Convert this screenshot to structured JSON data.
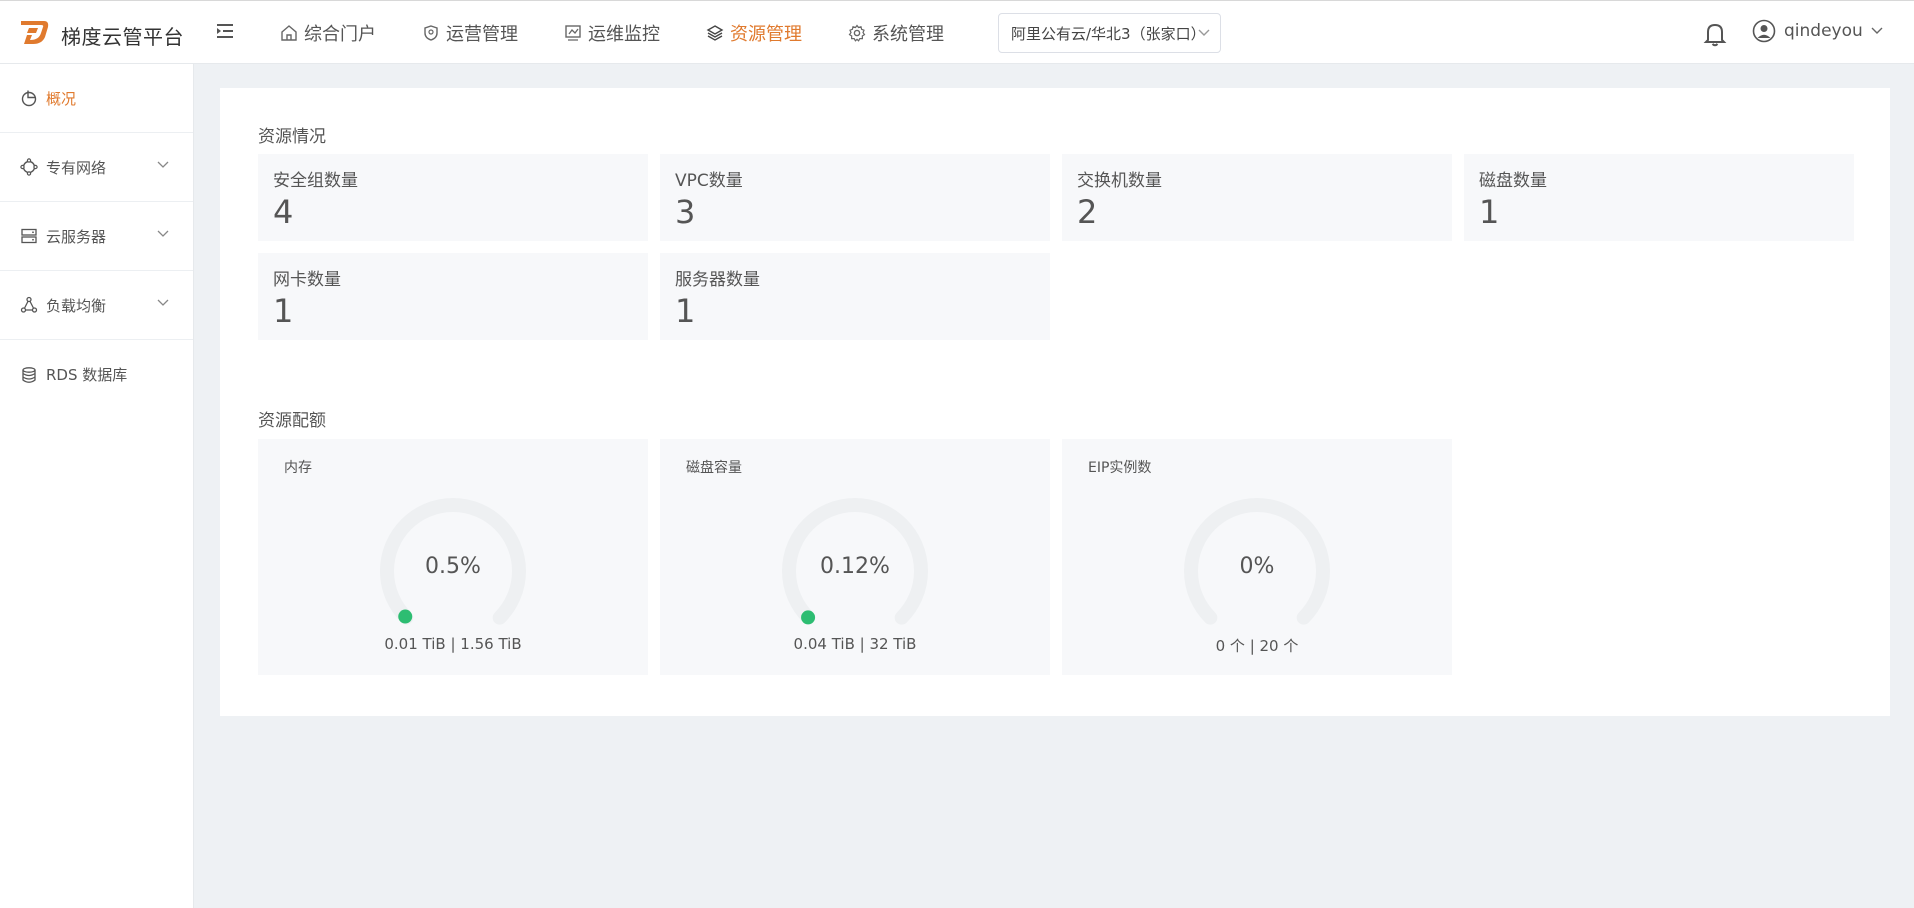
{
  "header": {
    "brand": "梯度云管平台",
    "nav": [
      {
        "label": "综合门户",
        "icon": "home-icon"
      },
      {
        "label": "运营管理",
        "icon": "shield-icon"
      },
      {
        "label": "运维监控",
        "icon": "monitor-icon"
      },
      {
        "label": "资源管理",
        "icon": "layers-icon",
        "active": true
      },
      {
        "label": "系统管理",
        "icon": "gear-icon"
      }
    ],
    "region": "阿里公有云/华北3（张家口）",
    "username": "qindeyou",
    "accent_color": "#e07a2e"
  },
  "sidebar": {
    "items": [
      {
        "label": "概况",
        "icon": "pie-chart-icon",
        "active": true,
        "expandable": false
      },
      {
        "label": "专有网络",
        "icon": "network-icon",
        "expandable": true
      },
      {
        "label": "云服务器",
        "icon": "server-icon",
        "expandable": true
      },
      {
        "label": "负载均衡",
        "icon": "load-balance-icon",
        "expandable": true
      },
      {
        "label": "RDS 数据库",
        "icon": "database-icon",
        "expandable": false
      }
    ]
  },
  "overview": {
    "title": "资源情况",
    "stats": [
      {
        "label": "安全组数量",
        "value": "4"
      },
      {
        "label": "VPC数量",
        "value": "3"
      },
      {
        "label": "交换机数量",
        "value": "2"
      },
      {
        "label": "磁盘数量",
        "value": "1"
      },
      {
        "label": "网卡数量",
        "value": "1"
      },
      {
        "label": "服务器数量",
        "value": "1"
      }
    ]
  },
  "quota": {
    "title": "资源配额",
    "gauges": [
      {
        "label": "内存",
        "percent_text": "0.5%",
        "percent": 0.5,
        "usage": "0.01 TiB | 1.56 TiB"
      },
      {
        "label": "磁盘容量",
        "percent_text": "0.12%",
        "percent": 0.12,
        "usage": "0.04 TiB | 32 TiB"
      },
      {
        "label": "EIP实例数",
        "percent_text": "0%",
        "percent": 0,
        "usage": "0 个 | 20 个"
      }
    ],
    "track_color": "#eef0f2",
    "indicator_color": "#2dbd72"
  }
}
